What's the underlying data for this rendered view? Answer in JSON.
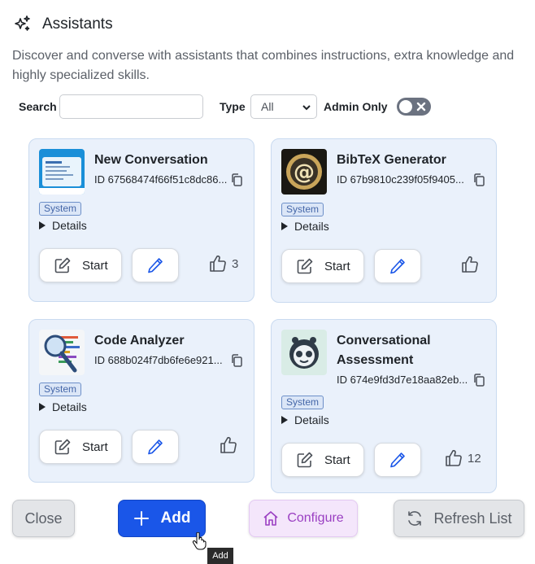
{
  "header": {
    "title": "Assistants",
    "icon": "sparkle-icon"
  },
  "description": "Discover and converse with assistants that combines instructions, extra knowledge and highly specialized skills.",
  "filters": {
    "search_label": "Search",
    "search_value": "",
    "type_label": "Type",
    "type_selected": "All",
    "admin_only_label": "Admin Only",
    "admin_only_on": false
  },
  "cards": [
    {
      "name": "New Conversation",
      "id": "ID 67568474f66f51c8dc86...",
      "tag": "System",
      "details": "Details",
      "start": "Start",
      "likes": "3"
    },
    {
      "name": "BibTeX Generator",
      "id": "ID 67b9810c239f05f9405...",
      "tag": "System",
      "details": "Details",
      "start": "Start",
      "likes": ""
    },
    {
      "name": "Code Analyzer",
      "id": "ID 688b024f7db6fe6e921...",
      "tag": "System",
      "details": "Details",
      "start": "Start",
      "likes": ""
    },
    {
      "name": "Conversational Assessment",
      "id": "ID 674e9fd3d7e18aa82eb...",
      "tag": "System",
      "details": "Details",
      "start": "Start",
      "likes": "12"
    }
  ],
  "footer": {
    "close": "Close",
    "add": "Add",
    "configure": "Configure",
    "refresh": "Refresh List"
  },
  "tooltip": "Add",
  "colors": {
    "primary": "#1a56e8",
    "card_bg": "#eaf1fb",
    "configure": "#9a3fc2"
  }
}
